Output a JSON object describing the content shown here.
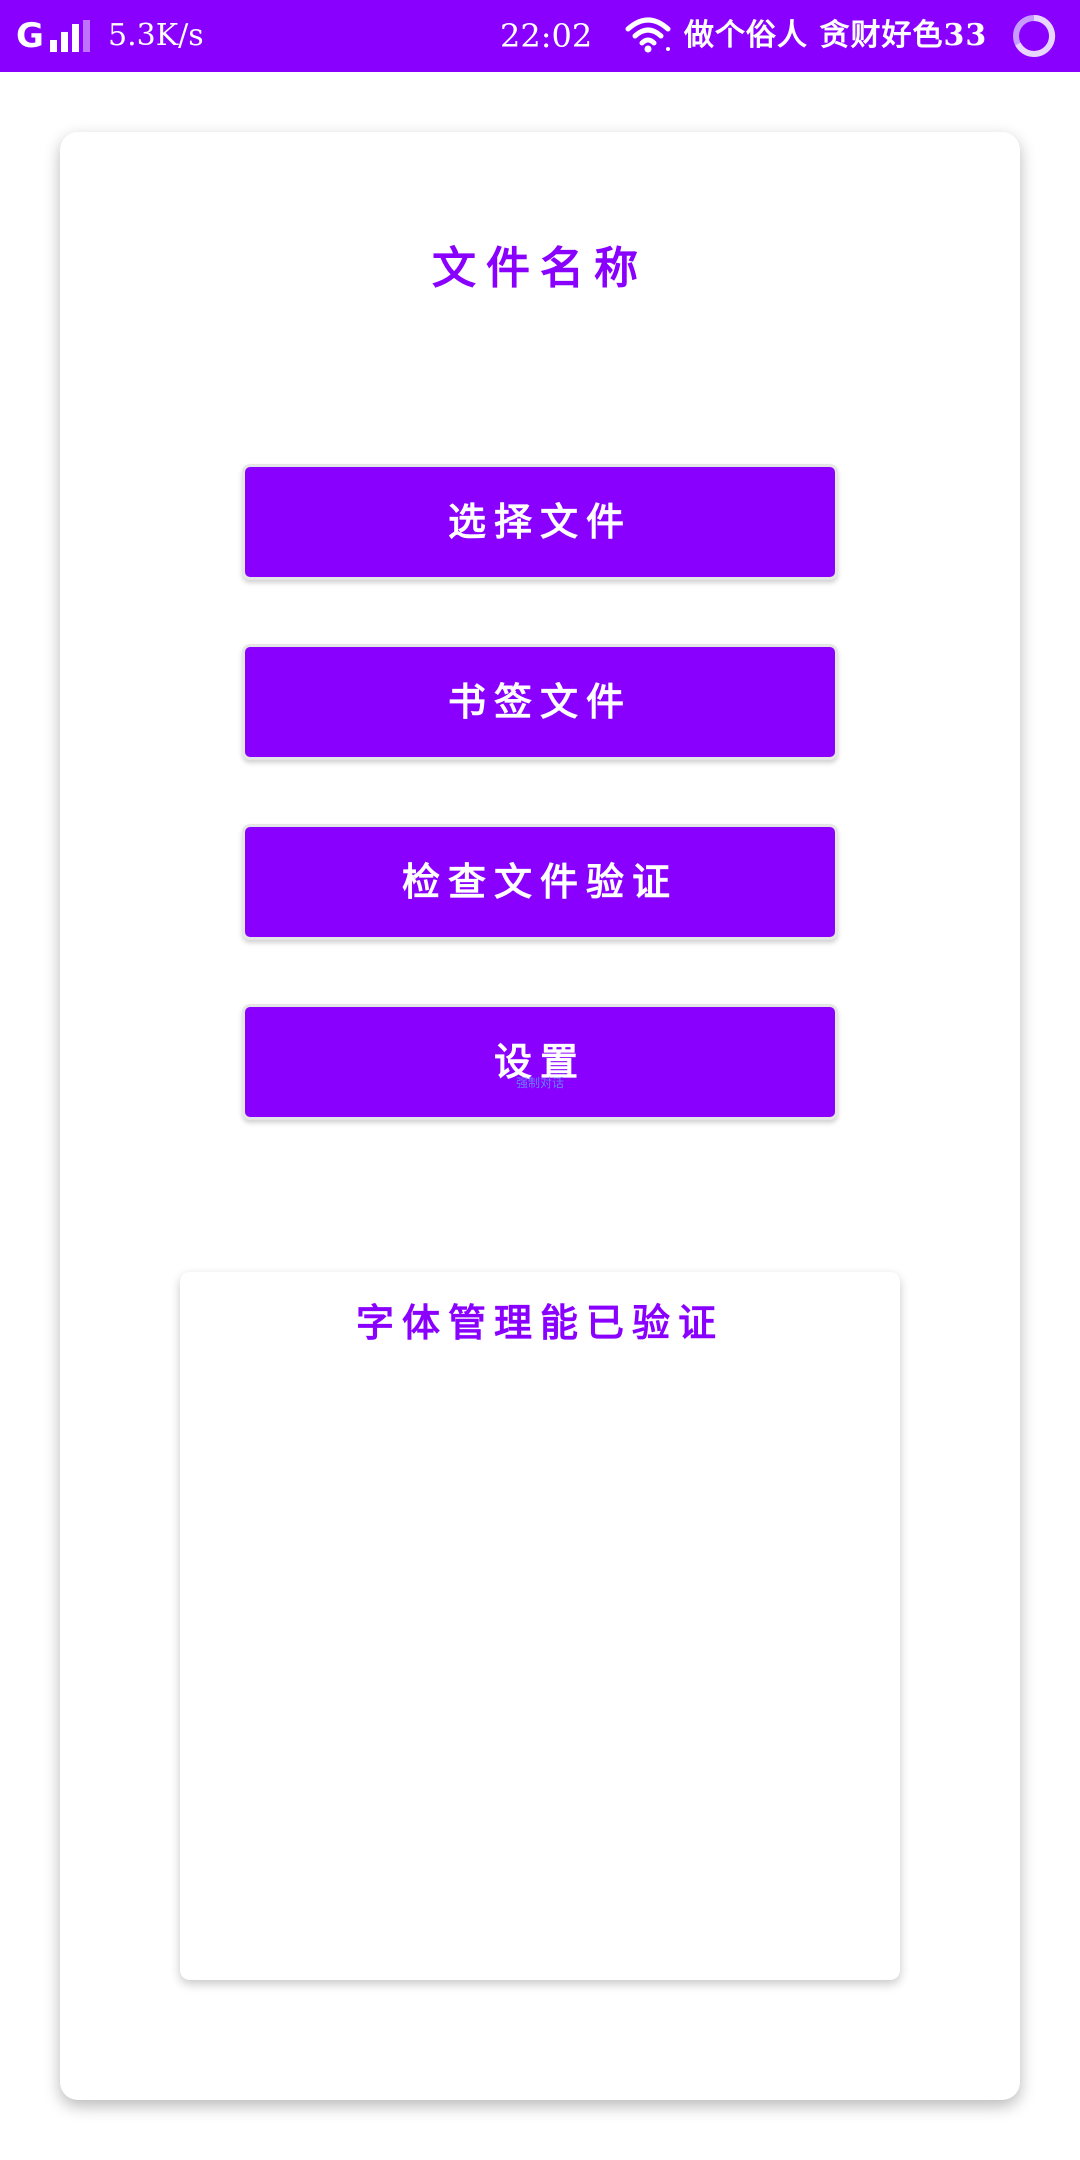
{
  "status_bar": {
    "carrier": "G",
    "net_speed": "5.3K/s",
    "time": "22:02",
    "text": "做个俗人 贪财好色33",
    "background": "#8a00ff",
    "icons": [
      "signal-icon",
      "wifi-icon",
      "battery-icon"
    ]
  },
  "main": {
    "title": "文件名称",
    "accent_color": "#8a00ff",
    "buttons": [
      {
        "label": "选择文件"
      },
      {
        "label": "书签文件"
      },
      {
        "label": "检查文件验证"
      },
      {
        "label": "设置",
        "sublabel": "强制对话"
      }
    ]
  },
  "panel": {
    "title": "字体管理能已验证"
  }
}
